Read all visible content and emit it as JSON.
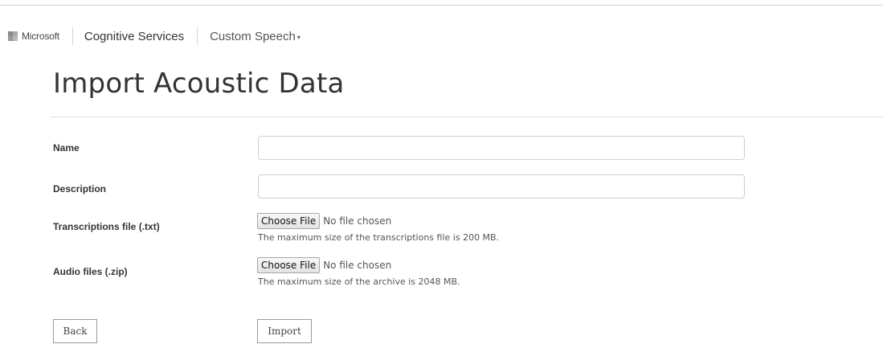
{
  "nav": {
    "brand": "Microsoft",
    "product": "Cognitive Services",
    "menu_label": "Custom Speech",
    "menu_caret": "▾"
  },
  "page": {
    "title": "Import Acoustic Data"
  },
  "form": {
    "name": {
      "label": "Name",
      "value": ""
    },
    "description": {
      "label": "Description",
      "value": ""
    },
    "transcriptions": {
      "label": "Transcriptions file (.txt)",
      "button_label": "Choose File",
      "status": "No file chosen",
      "hint": "The maximum size of the transcriptions file is 200 MB."
    },
    "audio": {
      "label": "Audio files (.zip)",
      "button_label": "Choose File",
      "status": "No file chosen",
      "hint": "The maximum size of the archive is 2048 MB."
    }
  },
  "actions": {
    "back_label": "Back",
    "import_label": "Import"
  },
  "icons": {
    "brand_logo": "microsoft-logo-icon",
    "dropdown": "chevron-down-icon"
  }
}
